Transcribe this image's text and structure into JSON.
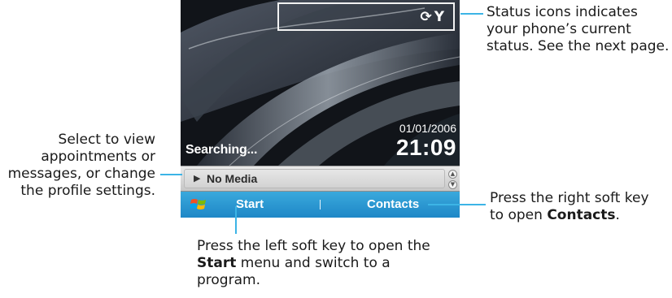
{
  "phone": {
    "status_icons": {
      "icons": [
        "sync-icon",
        "signal-antenna-icon"
      ],
      "glyphs": "ᕙ Y"
    },
    "searching_label": "Searching...",
    "date": "01/01/2006",
    "time": "21:09",
    "media_bar": {
      "label": "No Media",
      "icons": [
        "play-icon",
        "scroll-up-icon",
        "scroll-down-icon"
      ]
    },
    "softkeys": {
      "left": "Start",
      "right": "Contacts",
      "start_icon": "windows-flag-icon"
    }
  },
  "annotations": {
    "status_icons": "Status icons indicates your phone’s current status. See the next page.",
    "media_bar": "Select to view appointments or messages, or change the profile settings.",
    "left_softkey_pre": "Press the left soft key to open the ",
    "left_softkey_bold": "Start",
    "left_softkey_post": " menu and switch to a program.",
    "right_softkey_pre": "Press the right soft key to open ",
    "right_softkey_bold": "Contacts",
    "right_softkey_post": "."
  },
  "colors": {
    "leader_line": "#3cb4e6",
    "softbar": "#2a98d2",
    "media_bar": "#d8d8d8"
  }
}
